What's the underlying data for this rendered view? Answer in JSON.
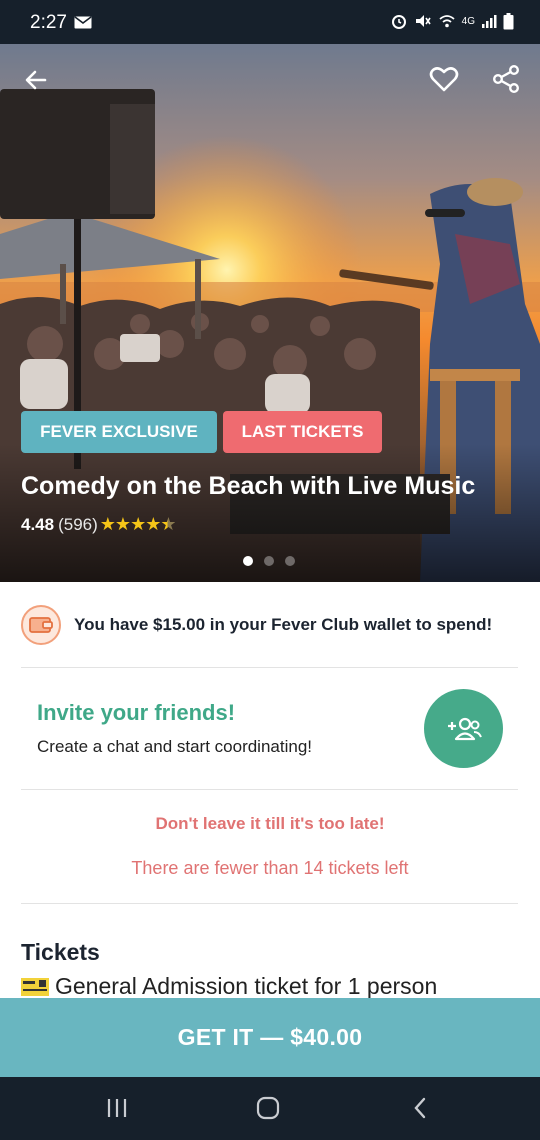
{
  "status_bar": {
    "time": "2:27",
    "network": "4G"
  },
  "hero": {
    "badges": {
      "exclusive": "FEVER EXCLUSIVE",
      "last_tickets": "LAST TICKETS"
    },
    "title": "Comedy on the Beach with Live Music",
    "rating": {
      "value": "4.48",
      "count": "(596)",
      "stars": 4.5
    },
    "carousel": {
      "total": 3,
      "active": 1
    }
  },
  "wallet": {
    "text": "You have $15.00 in your Fever Club wallet to spend!"
  },
  "invite": {
    "title": "Invite your friends!",
    "subtitle": "Create a chat and start coordinating!"
  },
  "warning": {
    "title": "Don't leave it till it's too late!",
    "subtitle": "There are fewer than 14 tickets left"
  },
  "tickets": {
    "heading": "Tickets",
    "item": "General Admission ticket for 1 person"
  },
  "cta": {
    "label": "GET IT — $40.00"
  },
  "colors": {
    "accent_teal": "#69b6c0",
    "badge_red": "#ef6b70",
    "invite_green": "#46aa8a",
    "warning_red": "#e07373"
  }
}
